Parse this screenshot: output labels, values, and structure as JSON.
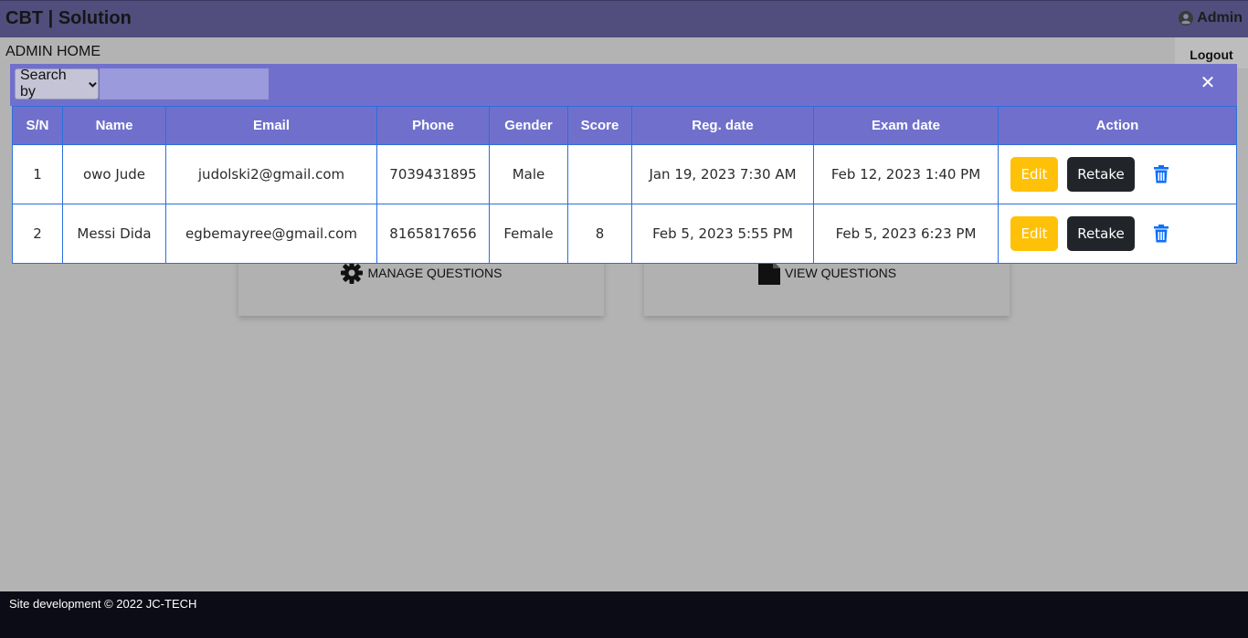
{
  "header": {
    "brand": "CBT | Solution",
    "user_label": "Admin"
  },
  "subbar": {
    "title": "ADMIN HOME",
    "logout_label": "Logout"
  },
  "cards": [
    {
      "label": "MANAGE QUESTIONS",
      "icon": "gear-icon"
    },
    {
      "label": "VIEW QUESTIONS",
      "icon": "document-icon"
    }
  ],
  "modal": {
    "search_label": "Search by",
    "search_value": "",
    "close_symbol": "✕"
  },
  "table": {
    "headers": [
      "S/N",
      "Name",
      "Email",
      "Phone",
      "Gender",
      "Score",
      "Reg. date",
      "Exam date",
      "Action"
    ],
    "rows": [
      {
        "sn": "1",
        "name": "owo Jude",
        "email": "judolski2@gmail.com",
        "phone": "7039431895",
        "gender": "Male",
        "score": "",
        "reg_date": "Jan 19, 2023 7:30 AM",
        "exam_date": "Feb 12, 2023 1:40 PM"
      },
      {
        "sn": "2",
        "name": "Messi Dida",
        "email": "egbemayree@gmail.com",
        "phone": "8165817656",
        "gender": "Female",
        "score": "8",
        "reg_date": "Feb 5, 2023 5:55 PM",
        "exam_date": "Feb 5, 2023 6:23 PM"
      }
    ],
    "edit_label": "Edit",
    "retake_label": "Retake"
  },
  "footer": {
    "text": "Site development © 2022 JC-TECH"
  },
  "colors": {
    "modal_header": "#7070cc",
    "edit": "#ffc107",
    "retake": "#212529",
    "trash": "#0d6efd",
    "navbar": "#514e7d"
  }
}
